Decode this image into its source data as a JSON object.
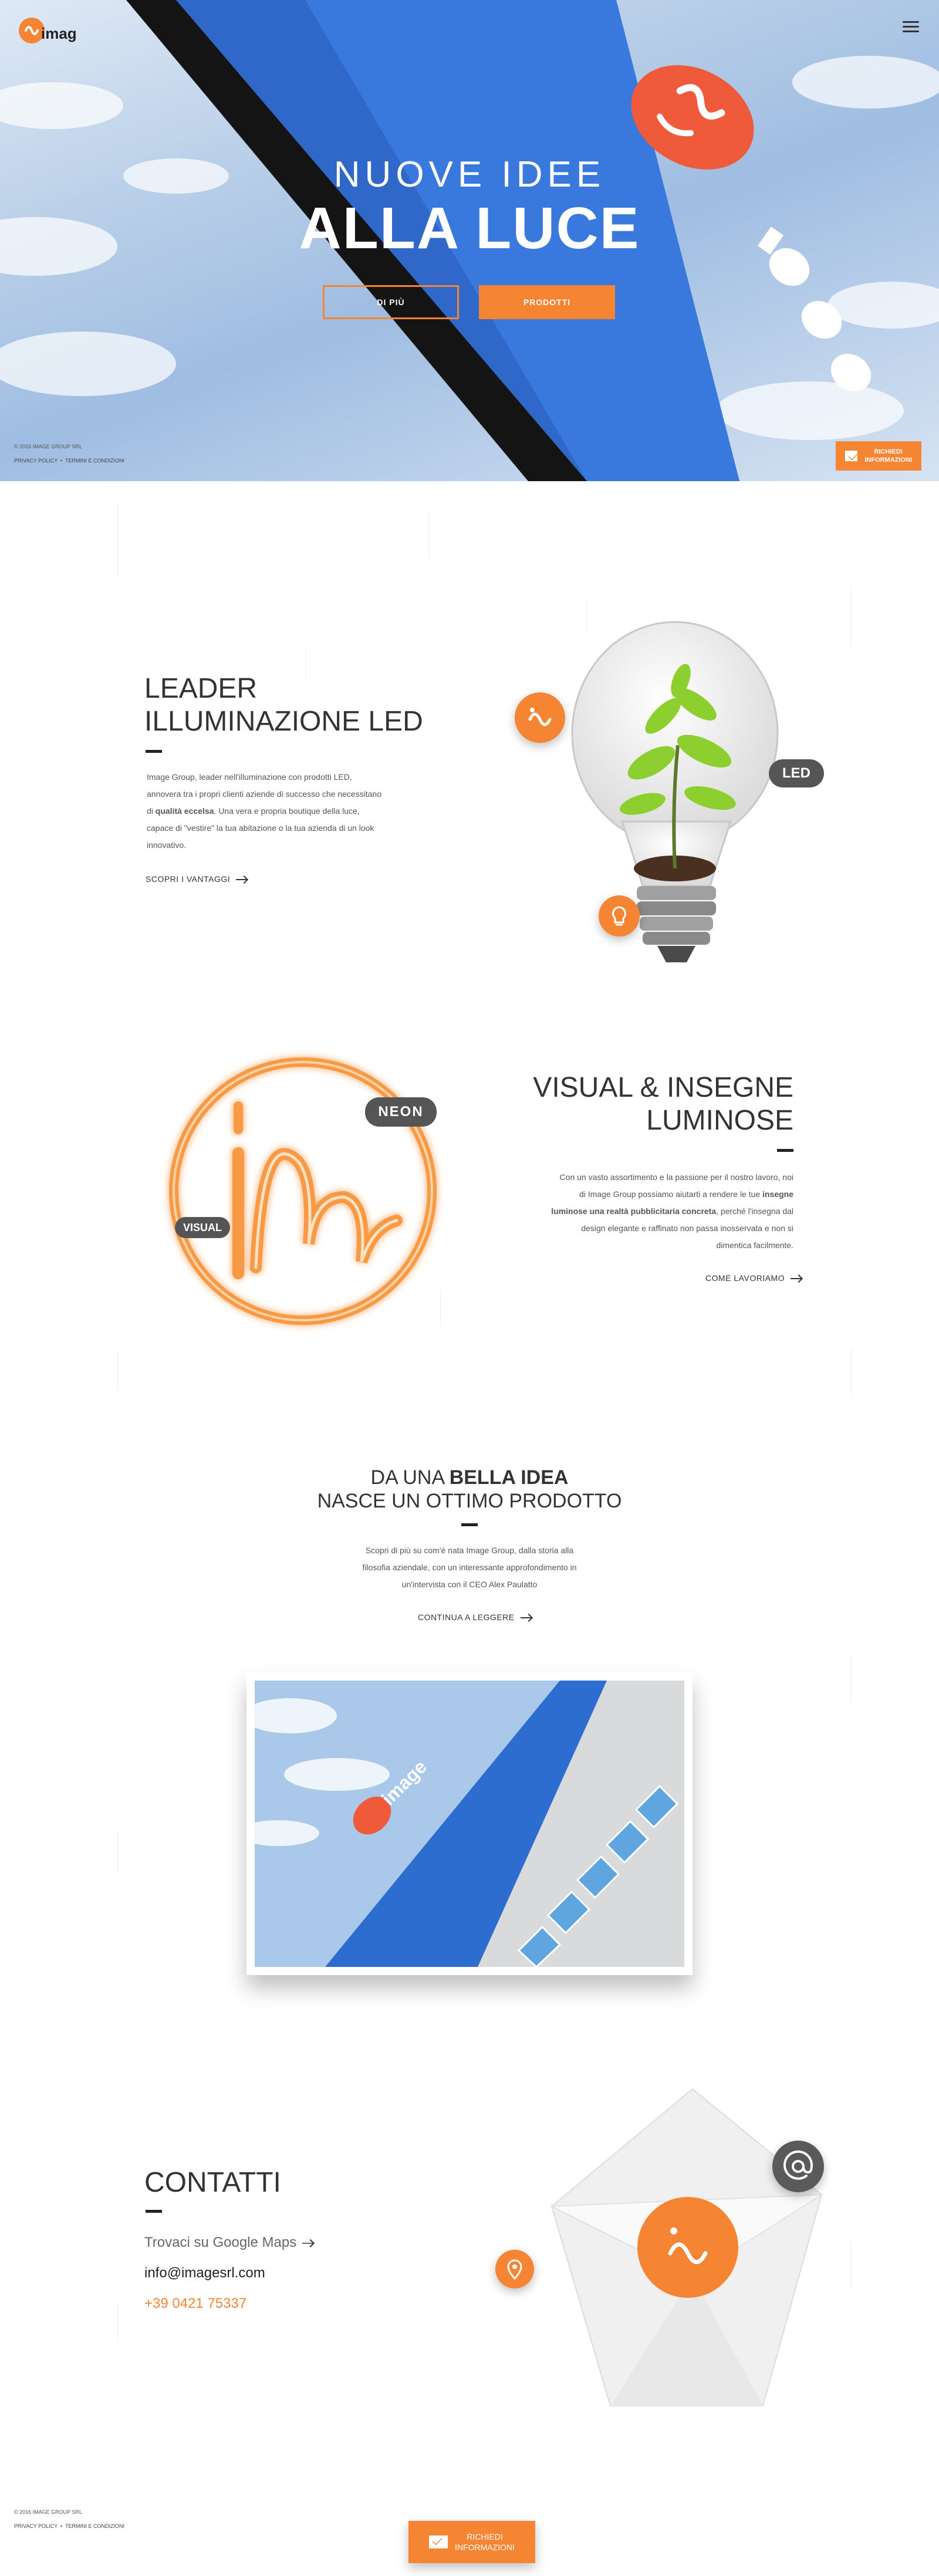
{
  "brand": {
    "logo_text": "image",
    "accent": "#f58433",
    "dark": "#333333"
  },
  "header": {
    "menu_icon": "hamburger-icon"
  },
  "hero": {
    "subtitle": "NUOVE IDEE",
    "title": "ALLA LUCE",
    "btn_more": "DI PIÙ",
    "btn_products": "PRODOTTI",
    "copyright": "© 2016 IMAGE GROUP SRL",
    "privacy": "PRIVACY POLICY",
    "terms": "TERMINI E CONDIZIONI",
    "request_line1": "RICHIEDI",
    "request_line2": "INFORMAZIONI"
  },
  "led": {
    "title_line1": "LEADER",
    "title_line2": "ILLUMINAZIONE LED",
    "text_1": "Image Group, leader nell'illuminazione con prodotti LED,",
    "text_2": "annovera tra i propri clienti aziende di successo che necessitano",
    "text_3_bold": "qualità eccelsa",
    "text_3_pre": "di ",
    "text_3_post": ". Una vera e propria boutique della luce,",
    "text_4": "capace di \"vestire\" la tua abitazione o la tua azienda di un look",
    "text_5": "innovativo.",
    "link": "SCOPRI I VANTAGGI",
    "badge": "LED"
  },
  "visual": {
    "title_line1": "VISUAL & INSEGNE",
    "title_line2": "LUMINOSE",
    "text_1": "Con un vasto assortimento e la passione per il nostro lavoro, noi",
    "text_2_pre": "di Image Group possiamo aiutarti a rendere le tue ",
    "text_2_bold": "insegne",
    "text_3_bold": "luminose una realtà pubblicitaria concreta",
    "text_3_post": ", perché l'insegna dal",
    "text_4": "design elegante e raffinato non passa inosservata e non si",
    "text_5": "dimentica facilmente.",
    "link": "COME LAVORIAMO",
    "badge_neon": "NEON",
    "badge_visual": "VISUAL"
  },
  "idea": {
    "title_pre": "DA UNA ",
    "title_bold": "BELLA IDEA",
    "title_line2": "NASCE UN OTTIMO PRODOTTO",
    "text_1": "Scopri di più su com'è nata Image Group, dalla storia alla",
    "text_2": "filosofia aziendale, con un interessante approfondimento in",
    "text_3": "un'intervista con il CEO Alex Paulatto",
    "link": "CONTINUA A LEGGERE",
    "photo_logo": "image"
  },
  "contacts": {
    "title": "CONTATTI",
    "maps": "Trovaci su Google Maps",
    "email": "info@imagesrl.com",
    "phone": "+39 0421 75337",
    "at_icon": "at-icon",
    "pin_icon": "map-pin-icon"
  },
  "footer": {
    "copyright": "© 2016 IMAGE GROUP SRL",
    "privacy": "PRIVACY POLICY",
    "terms": "TERMINI E CONDIZIONI",
    "request_line1": "RICHIEDI",
    "request_line2": "INFORMAZIONI"
  }
}
